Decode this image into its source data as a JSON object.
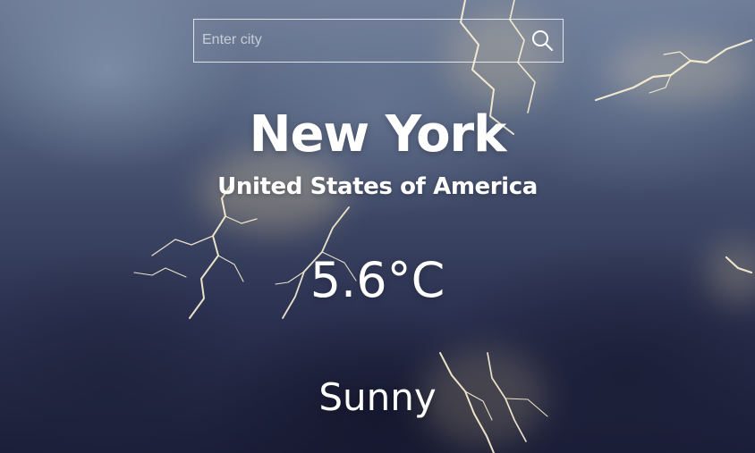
{
  "search": {
    "value": "",
    "placeholder": "Enter city",
    "icon": "search-icon"
  },
  "location": {
    "city": "New York",
    "country": "United States of America"
  },
  "weather": {
    "temperature": "5.6°C",
    "condition": "Sunny"
  },
  "colors": {
    "text": "#ffffff",
    "sky_top": "#6f7d98",
    "sky_bottom": "#1b1e38",
    "lightning": "#fff0c7"
  }
}
